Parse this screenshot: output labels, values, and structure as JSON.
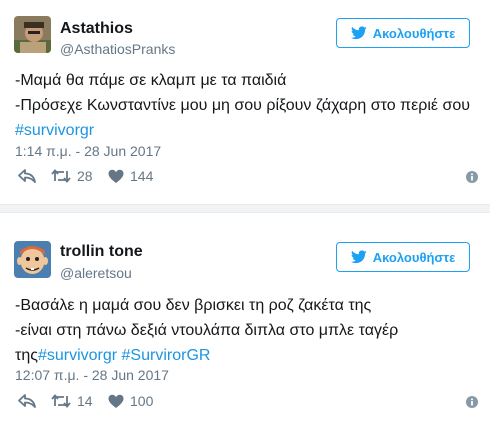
{
  "tweets": [
    {
      "name": "Astathios",
      "handle": "@AsthatiosPranks",
      "follow_label": "Ακολουθήστε",
      "lines": [
        {
          "text": "-Μαμά θα πάμε σε κλαμπ με τα παιδιά",
          "prefix": "",
          "tags": []
        },
        {
          "text": "-Πρόσεχε Κωνσταντίνε μου μη σου ρίξουν ζάχαρη στο περιέ σου",
          "prefix": "",
          "tags": []
        },
        {
          "text": "",
          "prefix": "",
          "tags": [
            "#survivorgr"
          ]
        }
      ],
      "timestamp": "1:14 π.μ. - 28 Jun 2017",
      "retweets": "28",
      "likes": "144"
    },
    {
      "name": "trollin tone",
      "handle": "@aleretsou",
      "follow_label": "Ακολουθήστε",
      "lines": [
        {
          "text": "-Βασάλε η μαμά σου δεν βρισκει τη ροζ ζακέτα της",
          "prefix": "",
          "tags": []
        },
        {
          "text": "-είναι στη πάνω δεξιά ντουλάπα διπλα στο μπλε ταγέρ",
          "prefix": "",
          "tags": []
        },
        {
          "text": "",
          "prefix": "της",
          "tags": [
            "#survivorgr",
            "#SurvirorGR"
          ]
        }
      ],
      "timestamp": "12:07 π.μ. - 28 Jun 2017",
      "retweets": "14",
      "likes": "100"
    }
  ],
  "icons": {
    "bird": "twitter-bird-icon",
    "reply": "reply-icon",
    "retweet": "retweet-icon",
    "like": "heart-icon",
    "info": "info-icon"
  },
  "colors": {
    "accent": "#1da1f2",
    "hashtag": "#1b95e0",
    "muted": "#657786",
    "text": "#14171a"
  }
}
